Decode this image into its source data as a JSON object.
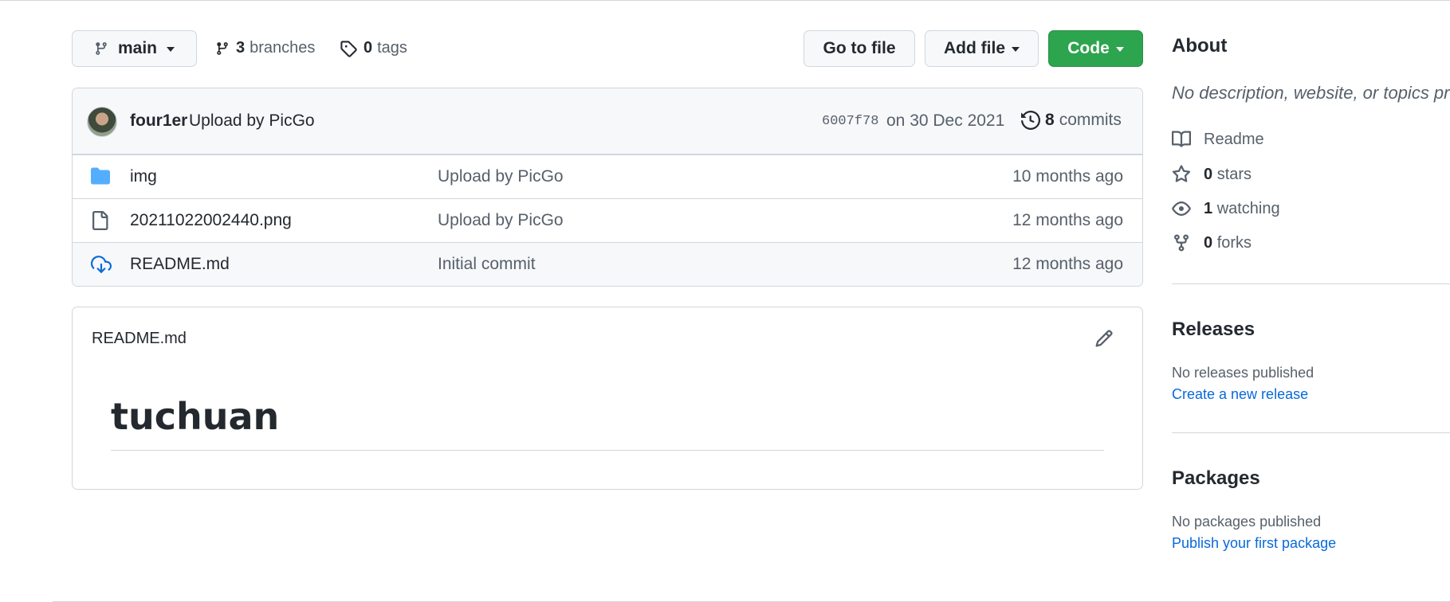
{
  "branch": {
    "name": "main"
  },
  "stats": {
    "branches_count": "3",
    "branches_label": "branches",
    "tags_count": "0",
    "tags_label": "tags"
  },
  "buttons": {
    "go_to_file": "Go to file",
    "add_file": "Add file",
    "code": "Code"
  },
  "commit": {
    "author": "four1er",
    "message": "Upload by PicGo",
    "sha": "6007f78",
    "date": "on 30 Dec 2021",
    "commits_count": "8",
    "commits_label": "commits"
  },
  "files": [
    {
      "name": "img",
      "type": "folder",
      "message": "Upload by PicGo",
      "age": "10 months ago"
    },
    {
      "name": "20211022002440.png",
      "type": "file",
      "message": "Upload by PicGo",
      "age": "12 months ago"
    },
    {
      "name": "README.md",
      "type": "readme",
      "message": "Initial commit",
      "age": "12 months ago"
    }
  ],
  "readme": {
    "filename": "README.md",
    "heading": "tuchuan"
  },
  "about": {
    "title": "About",
    "description": "No description, website, or topics provided.",
    "readme_label": "Readme",
    "stars_count": "0",
    "stars_label": "stars",
    "watching_count": "1",
    "watching_label": "watching",
    "forks_count": "0",
    "forks_label": "forks"
  },
  "releases": {
    "title": "Releases",
    "empty": "No releases published",
    "link": "Create a new release"
  },
  "packages": {
    "title": "Packages",
    "empty": "No packages published",
    "link": "Publish your first package"
  },
  "colors": {
    "accent": "#0969da",
    "primary_button": "#2da44e",
    "folder": "#54aeff",
    "border": "#d0d7de"
  }
}
